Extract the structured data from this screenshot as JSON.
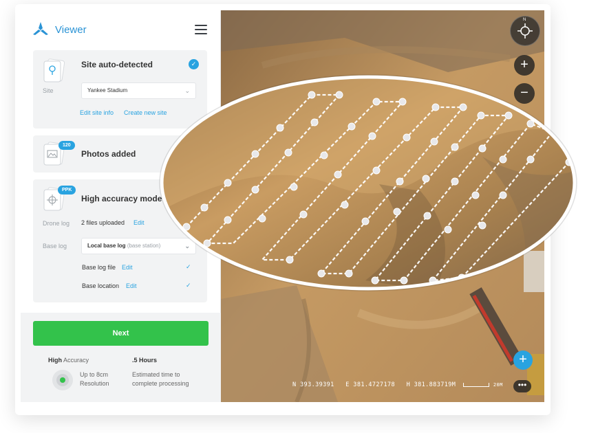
{
  "sidebar": {
    "app_title": "Viewer",
    "site_card": {
      "title": "Site auto-detected",
      "site_label": "Site",
      "site_value": "Yankee Stadium",
      "edit_site_info": "Edit site info",
      "create_new_site": "Create new site"
    },
    "photos_card": {
      "count_badge": "120",
      "title": "Photos added"
    },
    "accuracy_card": {
      "badge": "PPK",
      "title": "High accuracy mode",
      "drone_log_label": "Drone log",
      "drone_log_value": "2 files uploaded",
      "drone_log_edit": "Edit",
      "base_log_label": "Base log",
      "base_log_value": "Local base log",
      "base_log_sub": "(base station)",
      "base_log_file": "Base log file",
      "base_log_file_edit": "Edit",
      "base_location": "Base location",
      "base_location_edit": "Edit"
    },
    "footer": {
      "next_label": "Next",
      "accuracy_strong": "High",
      "accuracy_rest": " Accuracy",
      "resolution_line1": "Up to 8cm",
      "resolution_line2": "Resolution",
      "time_title": ".5 Hours",
      "time_line1": "Estimated time to",
      "time_line2": "complete processing"
    }
  },
  "map": {
    "compass_letter": "N",
    "zoom_in": "+",
    "zoom_out": "−",
    "add": "+",
    "more": "•••",
    "north": "N 393.39391",
    "east": "E 381.4727178",
    "height": "H 381.883719M",
    "scale": "20M"
  },
  "colors": {
    "accent": "#29a3e0",
    "next_green": "#33c24b",
    "title_blue": "#2a93d5"
  }
}
